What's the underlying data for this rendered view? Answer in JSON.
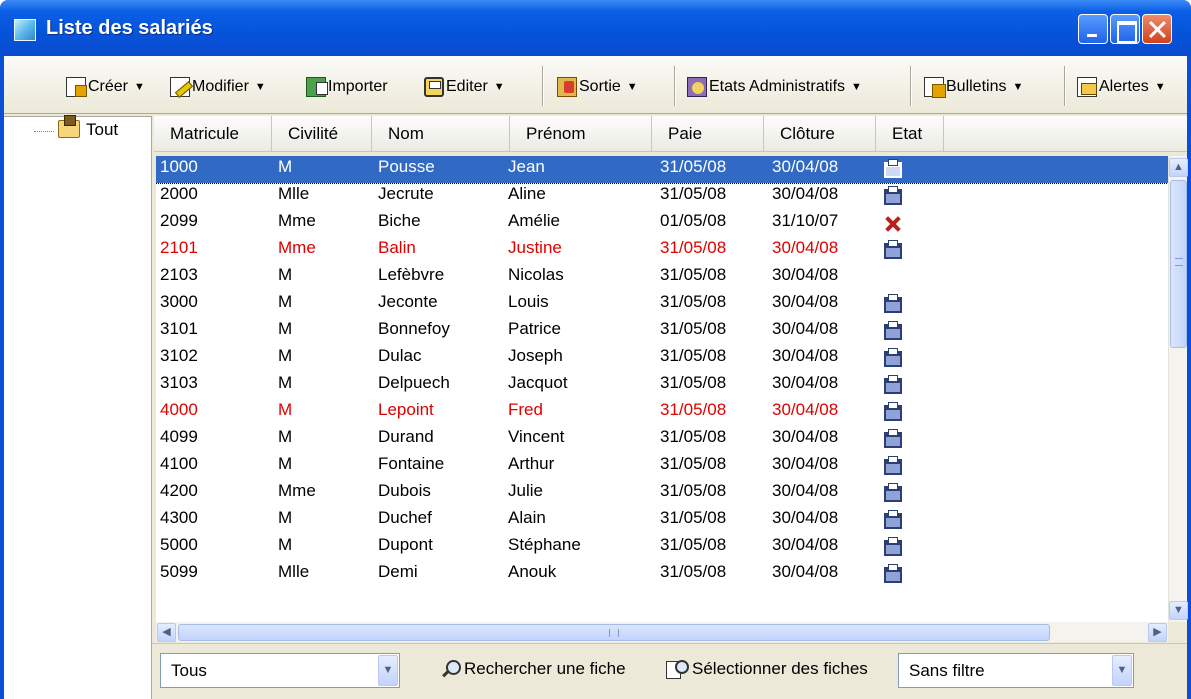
{
  "window": {
    "title": "Liste des salariés"
  },
  "toolbar": {
    "items": [
      {
        "label": "Créer",
        "icon": "create-doc-icon"
      },
      {
        "label": "Modifier",
        "icon": "edit-pencil-icon"
      },
      {
        "label": "Importer",
        "icon": "import-icon"
      },
      {
        "label": "Editer",
        "icon": "printer-icon"
      },
      {
        "label": "Sortie",
        "icon": "exit-icon"
      },
      {
        "label": "Etats Administratifs",
        "icon": "admin-reports-icon"
      },
      {
        "label": "Bulletins",
        "icon": "payslips-icon"
      },
      {
        "label": "Alertes",
        "icon": "alerts-icon"
      }
    ]
  },
  "tree": {
    "root_label": "Tout"
  },
  "table": {
    "columns": [
      "Matricule",
      "Civilité",
      "Nom",
      "Prénom",
      "Paie",
      "Clôture",
      "Etat"
    ],
    "rows": [
      {
        "matricule": "1000",
        "civilite": "M",
        "nom": "Pousse",
        "prenom": "Jean",
        "paie": "31/05/08",
        "cloture": "30/04/08",
        "etat": "printer",
        "selected": true,
        "red": false
      },
      {
        "matricule": "2000",
        "civilite": "Mlle",
        "nom": "Jecrute",
        "prenom": "Aline",
        "paie": "31/05/08",
        "cloture": "30/04/08",
        "etat": "printer",
        "selected": false,
        "red": false
      },
      {
        "matricule": "2099",
        "civilite": "Mme",
        "nom": "Biche",
        "prenom": "Amélie",
        "paie": "01/05/08",
        "cloture": "31/10/07",
        "etat": "cross",
        "selected": false,
        "red": false
      },
      {
        "matricule": "2101",
        "civilite": "Mme",
        "nom": "Balin",
        "prenom": "Justine",
        "paie": "31/05/08",
        "cloture": "30/04/08",
        "etat": "printer",
        "selected": false,
        "red": true
      },
      {
        "matricule": "2103",
        "civilite": "M",
        "nom": "Lefèbvre",
        "prenom": "Nicolas",
        "paie": "31/05/08",
        "cloture": "30/04/08",
        "etat": "",
        "selected": false,
        "red": false
      },
      {
        "matricule": "3000",
        "civilite": "M",
        "nom": "Jeconte",
        "prenom": "Louis",
        "paie": "31/05/08",
        "cloture": "30/04/08",
        "etat": "printer",
        "selected": false,
        "red": false
      },
      {
        "matricule": "3101",
        "civilite": "M",
        "nom": "Bonnefoy",
        "prenom": "Patrice",
        "paie": "31/05/08",
        "cloture": "30/04/08",
        "etat": "printer",
        "selected": false,
        "red": false
      },
      {
        "matricule": "3102",
        "civilite": "M",
        "nom": "Dulac",
        "prenom": "Joseph",
        "paie": "31/05/08",
        "cloture": "30/04/08",
        "etat": "printer",
        "selected": false,
        "red": false
      },
      {
        "matricule": "3103",
        "civilite": "M",
        "nom": "Delpuech",
        "prenom": "Jacquot",
        "paie": "31/05/08",
        "cloture": "30/04/08",
        "etat": "printer",
        "selected": false,
        "red": false
      },
      {
        "matricule": "4000",
        "civilite": "M",
        "nom": "Lepoint",
        "prenom": "Fred",
        "paie": "31/05/08",
        "cloture": "30/04/08",
        "etat": "printer",
        "selected": false,
        "red": true
      },
      {
        "matricule": "4099",
        "civilite": "M",
        "nom": "Durand",
        "prenom": "Vincent",
        "paie": "31/05/08",
        "cloture": "30/04/08",
        "etat": "printer",
        "selected": false,
        "red": false
      },
      {
        "matricule": "4100",
        "civilite": "M",
        "nom": "Fontaine",
        "prenom": "Arthur",
        "paie": "31/05/08",
        "cloture": "30/04/08",
        "etat": "printer",
        "selected": false,
        "red": false
      },
      {
        "matricule": "4200",
        "civilite": "Mme",
        "nom": "Dubois",
        "prenom": "Julie",
        "paie": "31/05/08",
        "cloture": "30/04/08",
        "etat": "printer",
        "selected": false,
        "red": false
      },
      {
        "matricule": "4300",
        "civilite": "M",
        "nom": "Duchef",
        "prenom": "Alain",
        "paie": "31/05/08",
        "cloture": "30/04/08",
        "etat": "printer",
        "selected": false,
        "red": false
      },
      {
        "matricule": "5000",
        "civilite": "M",
        "nom": "Dupont",
        "prenom": "Stéphane",
        "paie": "31/05/08",
        "cloture": "30/04/08",
        "etat": "printer",
        "selected": false,
        "red": false
      },
      {
        "matricule": "5099",
        "civilite": "Mlle",
        "nom": "Demi",
        "prenom": "Anouk",
        "paie": "31/05/08",
        "cloture": "30/04/08",
        "etat": "printer",
        "selected": false,
        "red": false
      }
    ]
  },
  "bottom": {
    "scope_value": "Tous",
    "search_label": "Rechercher une fiche",
    "select_label": "Sélectionner des fiches",
    "filter_value": "Sans filtre"
  },
  "colors": {
    "selection": "#316ac5",
    "highlight_text": "#e00000",
    "titlebar": "#0653d9"
  }
}
